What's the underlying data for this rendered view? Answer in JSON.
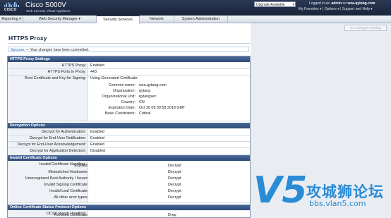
{
  "header": {
    "brand": "CISCO",
    "product": "Cisco S000V",
    "subtitle": "Web Security Virtual Appliance",
    "upgrade_label": "Upgrade Available",
    "logged_prefix": "Logged in as:",
    "user": "admin",
    "host_prefix": "on",
    "host": "wsa.qytang.com",
    "links": [
      "My Favorites",
      "Options",
      "Support and Help"
    ]
  },
  "tabs": [
    "Reporting",
    "Web Security Manager",
    "Security Services",
    "Network",
    "System Administration"
  ],
  "no_changes_label": "No Changes Pending",
  "page_title": "HTTPS Proxy",
  "success": {
    "label": "Success",
    "sep": "—",
    "message": "Your changes have been committed."
  },
  "sections": {
    "https_settings": "HTTPS Proxy Settings",
    "decryption": "Decryption Options",
    "invalid_cert": "Invalid Certificate Options",
    "ocsp": "Online Certificate Status Protocol Options"
  },
  "https_rows": [
    {
      "label": "HTTPS Proxy:",
      "value": "Enabled"
    },
    {
      "label": "HTTPS Ports to Proxy:",
      "value": "443"
    },
    {
      "label": "Root Certificate and Key for Signing:",
      "value": "Using Generated Certificate:"
    }
  ],
  "cert_details": [
    {
      "k": "Common name:",
      "v": "wsa.qytang.com"
    },
    {
      "k": "Organization:",
      "v": "qytang"
    },
    {
      "k": "Organizational Unit:",
      "v": "qytangsec"
    },
    {
      "k": "Country:",
      "v": "CN"
    },
    {
      "k": "Expiration Date:",
      "v": "Oct 30 09:39:58 2018 GMT"
    },
    {
      "k": "Basic Constraints:",
      "v": "Critical"
    }
  ],
  "decryption_rows": [
    {
      "label": "Decrypt for Authentication:",
      "value": "Enabled"
    },
    {
      "label": "Decrypt for End-User Notification:",
      "value": "Enabled"
    },
    {
      "label": "Decrypt for End-User Acknowledgement:",
      "value": "Enabled"
    },
    {
      "label": "Decrypt for Application Detection:",
      "value": "Disabled"
    }
  ],
  "invalid_label": "Invalid Certificate Handling:",
  "invalid_details": [
    {
      "k": "Expired:",
      "v": "Decrypt"
    },
    {
      "k": "Mismatched Hostname:",
      "v": "Decrypt"
    },
    {
      "k": "Unrecognized Root Authority / Issuer:",
      "v": "Decrypt"
    },
    {
      "k": "Invalid Signing Certificate:",
      "v": "Decrypt"
    },
    {
      "k": "Invalid Leaf Certificate:",
      "v": "Decrypt"
    },
    {
      "k": "All other error types:",
      "v": "Decrypt"
    }
  ],
  "ocsp_label": "OCSP Result Handling:",
  "ocsp_details": [
    {
      "k": "Revoked Certificate:",
      "v": "Drop"
    }
  ],
  "watermark": {
    "v": "V5",
    "cn": "攻城狮论坛",
    "url": "bbs.vlan5.com"
  }
}
